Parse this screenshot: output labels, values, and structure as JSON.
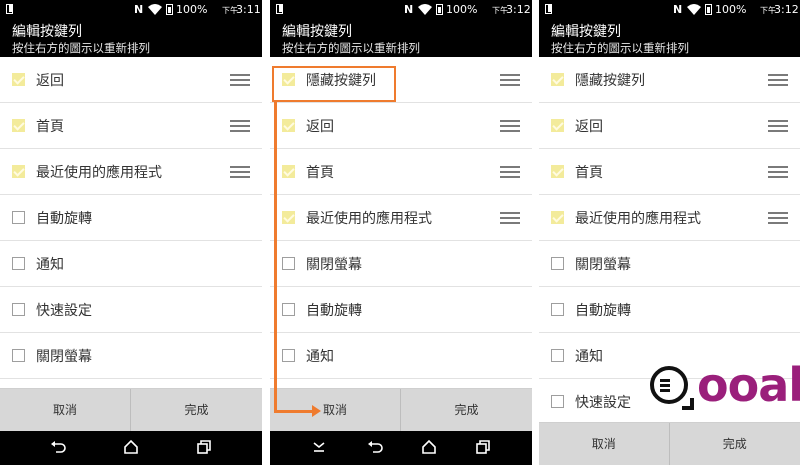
{
  "status": {
    "nfc": "N",
    "battery_pct": "100%",
    "ampm": "下午",
    "panels_time": [
      "3:11",
      "3:12",
      "3:12"
    ]
  },
  "header": {
    "title": "編輯按鍵列",
    "subtitle": "按住右方的圖示以重新排列"
  },
  "panels": [
    {
      "items": [
        {
          "label": "返回",
          "checked": true
        },
        {
          "label": "首頁",
          "checked": true
        },
        {
          "label": "最近使用的應用程式",
          "checked": true
        },
        {
          "label": "自動旋轉",
          "checked": false
        },
        {
          "label": "通知",
          "checked": false
        },
        {
          "label": "快速設定",
          "checked": false
        },
        {
          "label": "關閉螢幕",
          "checked": false
        }
      ]
    },
    {
      "items": [
        {
          "label": "隱藏按鍵列",
          "checked": true
        },
        {
          "label": "返回",
          "checked": true
        },
        {
          "label": "首頁",
          "checked": true
        },
        {
          "label": "最近使用的應用程式",
          "checked": true
        },
        {
          "label": "關閉螢幕",
          "checked": false
        },
        {
          "label": "自動旋轉",
          "checked": false
        },
        {
          "label": "通知",
          "checked": false
        }
      ]
    },
    {
      "items": [
        {
          "label": "隱藏按鍵列",
          "checked": true
        },
        {
          "label": "返回",
          "checked": true
        },
        {
          "label": "首頁",
          "checked": true
        },
        {
          "label": "最近使用的應用程式",
          "checked": true
        },
        {
          "label": "關閉螢幕",
          "checked": false
        },
        {
          "label": "自動旋轉",
          "checked": false
        },
        {
          "label": "通知",
          "checked": false
        },
        {
          "label": "快速設定",
          "checked": false
        }
      ]
    }
  ],
  "buttons": {
    "cancel": "取消",
    "done": "完成"
  },
  "nav_icons": {
    "panel0": [
      "back-icon",
      "home-icon",
      "recents-icon"
    ],
    "panel1": [
      "hide-navbar-icon",
      "back-icon",
      "home-icon",
      "recents-icon"
    ]
  },
  "logo": {
    "text": "ooah"
  },
  "colors": {
    "accent_annotation": "#ef7b2e",
    "checkbox_checked": "#f3eb9b",
    "logo_purple": "#9a1f7b"
  }
}
